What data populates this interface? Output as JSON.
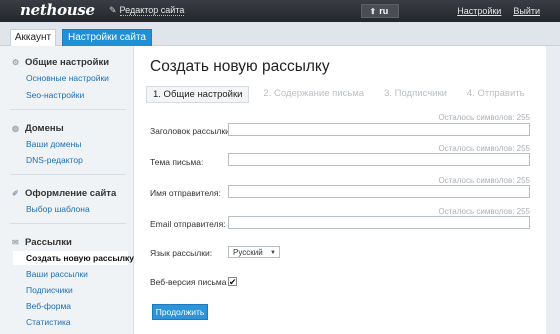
{
  "topbar": {
    "logo": "nethouse",
    "editor_link": "Редактор сайта",
    "lang": "ru",
    "settings_link": "Настройки",
    "logout_link": "Выйти"
  },
  "tabs": [
    {
      "label": "Аккаунт"
    },
    {
      "label": "Настройки сайта"
    }
  ],
  "sidebar": {
    "sections": [
      {
        "title": "Общие настройки",
        "items": [
          "Основные настройки",
          "Seo-настройки"
        ]
      },
      {
        "title": "Домены",
        "items": [
          "Ваши домены",
          "DNS-редактор"
        ]
      },
      {
        "title": "Оформление сайта",
        "items": [
          "Выбор шаблона"
        ]
      },
      {
        "title": "Рассылки",
        "items": [
          "Создать новую рассылку",
          "Ваши рассылки",
          "Подписчики",
          "Веб-форма",
          "Статистика"
        ]
      }
    ]
  },
  "main": {
    "title": "Создать новую рассылку",
    "steps": [
      "1. Общие настройки",
      "2. Содержание письма",
      "3. Подписчики",
      "4. Отправить"
    ],
    "remaining_text": "Осталось символов: 255",
    "fields": [
      {
        "label": "Заголовок рассылки:",
        "value": ""
      },
      {
        "label": "Тема письма:",
        "value": ""
      },
      {
        "label": "Имя отправителя:",
        "value": ""
      },
      {
        "label": "Email отправителя:",
        "value": ""
      }
    ],
    "language_label": "Язык рассылки:",
    "language_value": "Русский",
    "web_version_label": "Веб-версия письма",
    "submit": "Продолжить"
  }
}
